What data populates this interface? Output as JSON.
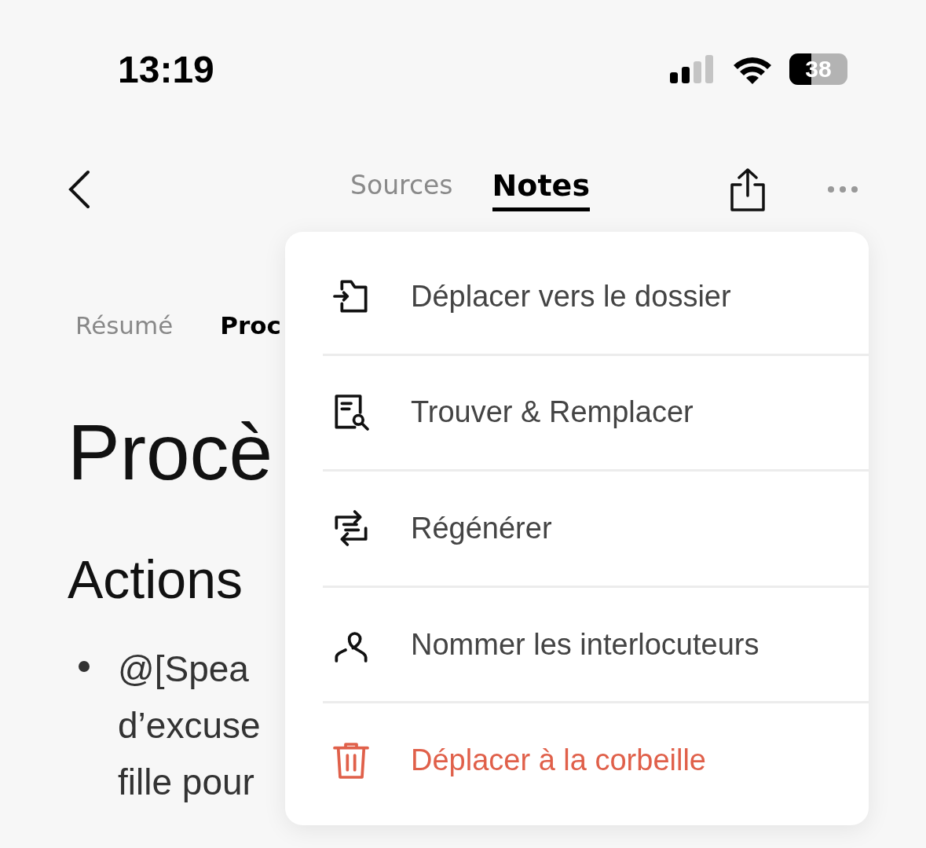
{
  "status_bar": {
    "time": "13:19",
    "battery": "38"
  },
  "nav": {
    "tabs": [
      {
        "label": "Sources",
        "selected": false
      },
      {
        "label": "Notes",
        "selected": true
      }
    ]
  },
  "sub_tabs": [
    {
      "label": "Résumé",
      "selected": false
    },
    {
      "label": "Proc",
      "selected": true
    }
  ],
  "document": {
    "title": "Procè",
    "heading": "Actions",
    "bullet_lines": [
      "@[Spea",
      "d’excuse",
      "fille pour"
    ]
  },
  "menu": {
    "items": [
      {
        "label": "Déplacer vers le dossier",
        "kind": "move"
      },
      {
        "label": "Trouver & Remplacer",
        "kind": "find"
      },
      {
        "label": "Régénérer",
        "kind": "regenerate"
      },
      {
        "label": "Nommer les interlocuteurs",
        "kind": "speakers"
      },
      {
        "label": "Déplacer à la corbeille",
        "kind": "trash"
      }
    ]
  }
}
